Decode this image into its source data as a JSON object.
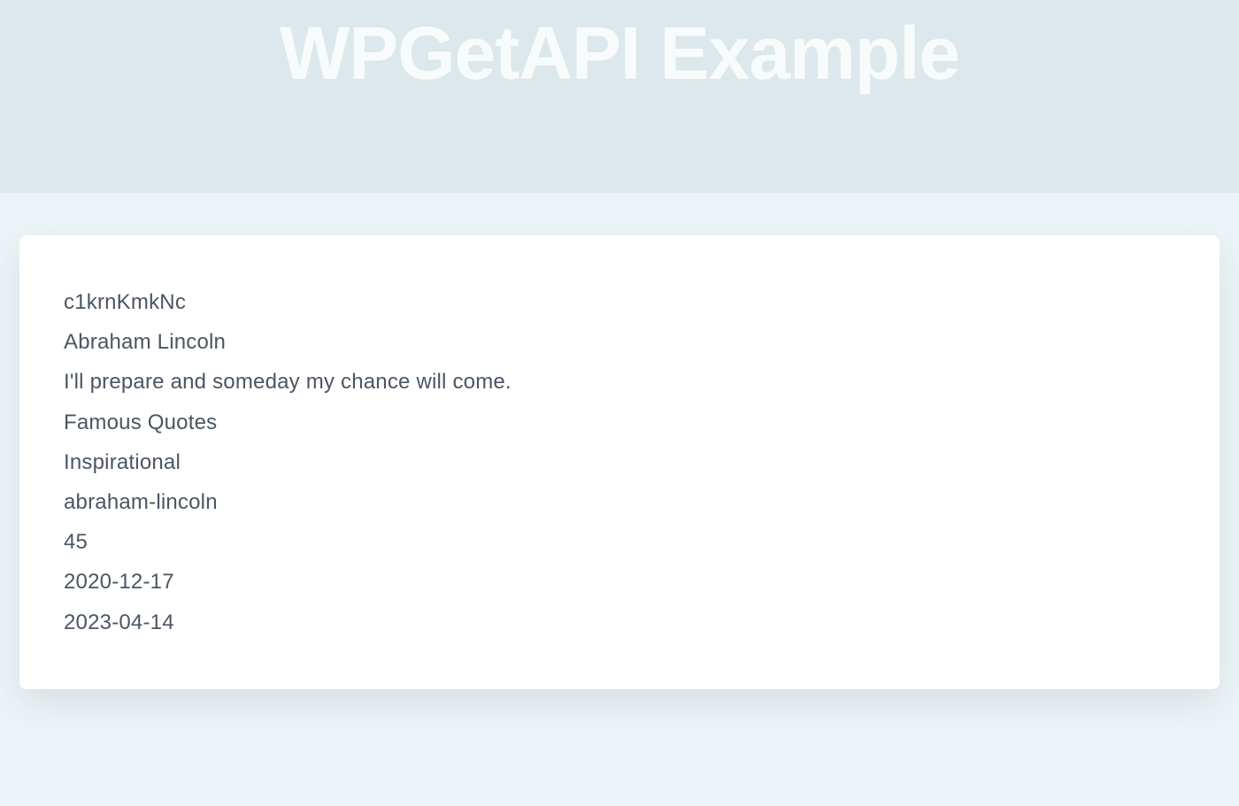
{
  "hero": {
    "title": "WPGetAPI Example"
  },
  "card": {
    "lines": [
      "c1krnKmkNc",
      "Abraham Lincoln",
      "I'll prepare and someday my chance will come.",
      "Famous Quotes",
      "Inspirational",
      "abraham-lincoln",
      "45",
      "2020-12-17",
      "2023-04-14"
    ]
  }
}
